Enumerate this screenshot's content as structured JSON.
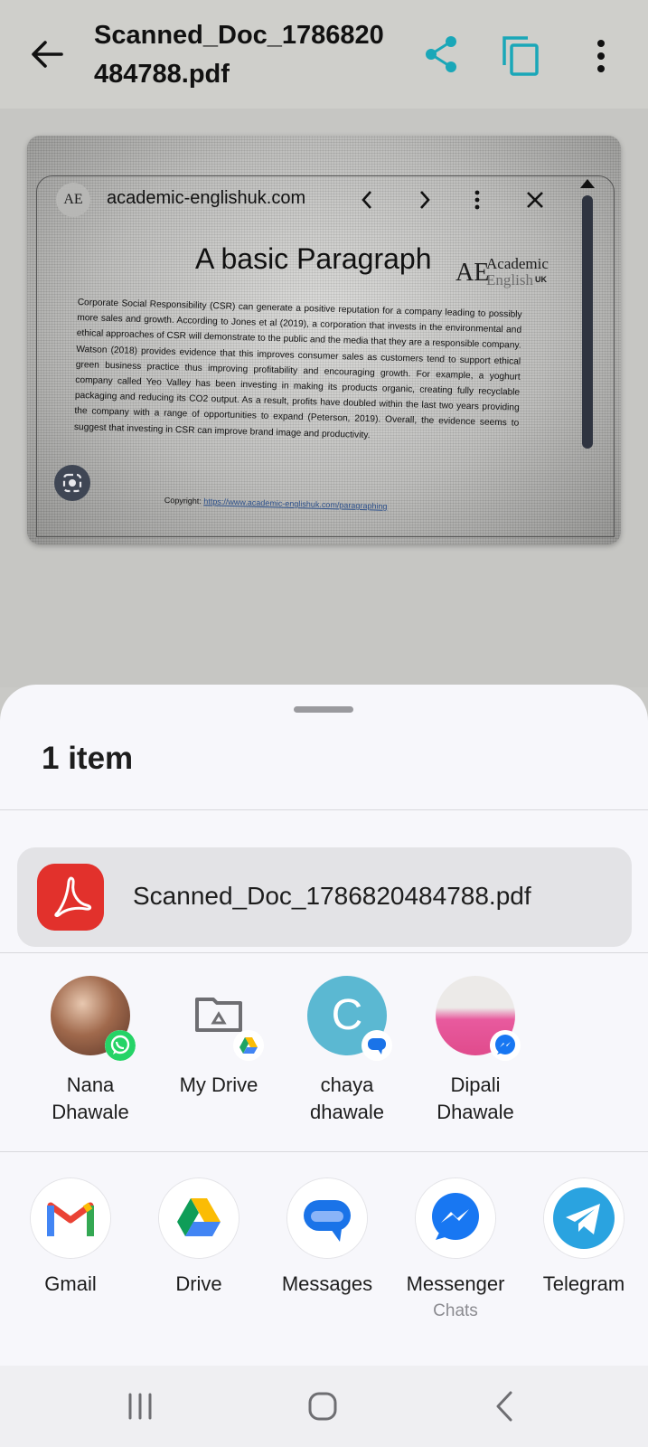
{
  "app_bar": {
    "title": "Scanned_Doc_1786820484788.pdf",
    "icons": [
      "back-arrow-icon",
      "share-icon",
      "copy-icon",
      "more-vert-icon"
    ],
    "accent_color": "#1aa7b8"
  },
  "preview": {
    "browser_logo_text": "AE",
    "browser_url": "academic-englishuk.com",
    "heading": "A basic Paragraph",
    "logo_line1": "Academic",
    "logo_line2": "English",
    "logo_uk": "UK",
    "paragraph": "Corporate Social Responsibility (CSR) can generate a positive reputation for a company leading to possibly more sales and growth. According to Jones et al (2019), a corporation that invests in the environmental and ethical approaches of CSR will demonstrate to the public and the media that they are a responsible company. Watson (2018) provides evidence that this improves consumer sales as customers tend to support ethical green business practice thus improving profitability and encouraging growth. For example, a yoghurt company called Yeo Valley has been investing in making its products organic, creating fully recyclable packaging and reducing its CO2 output. As a result, profits have doubled within the last two years providing the company with a range of opportunities to expand (Peterson, 2019). Overall, the evidence seems to suggest that investing in CSR can improve brand image and productivity.",
    "copyright_label": "Copyright:",
    "copyright_link": "https://www.academic-englishuk.com/paragraphing"
  },
  "share_sheet": {
    "title": "1 item",
    "file_name": "Scanned_Doc_1786820484788.pdf",
    "contacts": [
      {
        "name": "Nana Dhawale",
        "badge": "whatsapp-icon"
      },
      {
        "name": "My Drive",
        "badge": "google-drive-icon"
      },
      {
        "name": "chaya dhawale",
        "initial": "C",
        "badge": "messages-icon"
      },
      {
        "name": "Dipali Dhawale",
        "badge": "messenger-icon"
      }
    ],
    "apps": [
      {
        "label": "Gmail",
        "sub": ""
      },
      {
        "label": "Drive",
        "sub": ""
      },
      {
        "label": "Messages",
        "sub": ""
      },
      {
        "label": "Messenger",
        "sub": "Chats"
      },
      {
        "label": "Telegram",
        "sub": ""
      }
    ]
  },
  "nav_bar": {
    "buttons": [
      "recents-icon",
      "home-icon",
      "back-icon"
    ]
  }
}
